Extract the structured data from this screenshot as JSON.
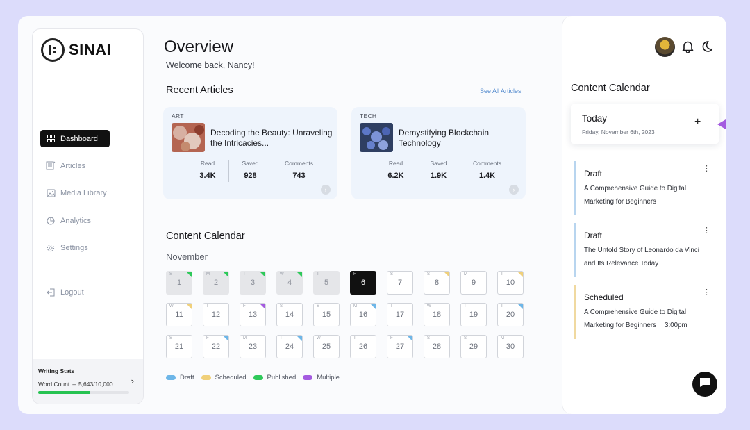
{
  "app": {
    "name": "SINAI"
  },
  "sidebar": {
    "items": [
      {
        "label": "Dashboard",
        "icon": "grid-icon",
        "active": true
      },
      {
        "label": "Articles",
        "icon": "articles-icon"
      },
      {
        "label": "Media Library",
        "icon": "image-icon"
      },
      {
        "label": "Analytics",
        "icon": "pie-chart-icon"
      },
      {
        "label": "Settings",
        "icon": "gear-icon"
      }
    ],
    "logout_label": "Logout",
    "writing_stats": {
      "title": "Writing Stats",
      "label": "Word Count",
      "value": "5,643/10,000",
      "progress": 0.5643
    }
  },
  "header": {
    "title": "Overview",
    "welcome": "Welcome back, Nancy!"
  },
  "recent": {
    "title": "Recent Articles",
    "see_all": "See All Articles",
    "articles": [
      {
        "category": "ART",
        "title": "Decoding the Beauty: Unraveling the Intricacies...",
        "read_label": "Read",
        "read": "3.4K",
        "saved_label": "Saved",
        "saved": "928",
        "comments_label": "Comments",
        "comments": "743"
      },
      {
        "category": "TECH",
        "title": "Demystifying Blockchain Technology",
        "read_label": "Read",
        "read": "6.2K",
        "saved_label": "Saved",
        "saved": "1.9K",
        "comments_label": "Comments",
        "comments": "1.4K"
      }
    ]
  },
  "calendar": {
    "title": "Content Calendar",
    "month": "November",
    "days": [
      {
        "n": "1",
        "wd": "S",
        "state": "past",
        "mark": "published"
      },
      {
        "n": "2",
        "wd": "M",
        "state": "past",
        "mark": "published"
      },
      {
        "n": "3",
        "wd": "T",
        "state": "past",
        "mark": "published"
      },
      {
        "n": "4",
        "wd": "W",
        "state": "past",
        "mark": "published"
      },
      {
        "n": "5",
        "wd": "T",
        "state": "past",
        "mark": ""
      },
      {
        "n": "6",
        "wd": "F",
        "state": "today",
        "mark": ""
      },
      {
        "n": "7",
        "wd": "S",
        "state": "",
        "mark": ""
      },
      {
        "n": "8",
        "wd": "S",
        "state": "",
        "mark": "scheduled"
      },
      {
        "n": "9",
        "wd": "M",
        "state": "",
        "mark": ""
      },
      {
        "n": "10",
        "wd": "T",
        "state": "",
        "mark": "scheduled"
      },
      {
        "n": "11",
        "wd": "W",
        "state": "",
        "mark": "scheduled"
      },
      {
        "n": "12",
        "wd": "T",
        "state": "",
        "mark": ""
      },
      {
        "n": "13",
        "wd": "F",
        "state": "",
        "mark": "multiple"
      },
      {
        "n": "14",
        "wd": "S",
        "state": "",
        "mark": ""
      },
      {
        "n": "15",
        "wd": "S",
        "state": "",
        "mark": ""
      },
      {
        "n": "16",
        "wd": "M",
        "state": "",
        "mark": "draft"
      },
      {
        "n": "17",
        "wd": "T",
        "state": "",
        "mark": ""
      },
      {
        "n": "18",
        "wd": "W",
        "state": "",
        "mark": ""
      },
      {
        "n": "19",
        "wd": "T",
        "state": "",
        "mark": ""
      },
      {
        "n": "20",
        "wd": "T",
        "state": "",
        "mark": "draft"
      },
      {
        "n": "21",
        "wd": "S",
        "state": "",
        "mark": ""
      },
      {
        "n": "22",
        "wd": "F",
        "state": "",
        "mark": "draft"
      },
      {
        "n": "23",
        "wd": "M",
        "state": "",
        "mark": ""
      },
      {
        "n": "24",
        "wd": "T",
        "state": "",
        "mark": "draft"
      },
      {
        "n": "25",
        "wd": "W",
        "state": "",
        "mark": ""
      },
      {
        "n": "26",
        "wd": "T",
        "state": "",
        "mark": ""
      },
      {
        "n": "27",
        "wd": "F",
        "state": "",
        "mark": "draft"
      },
      {
        "n": "28",
        "wd": "S",
        "state": "",
        "mark": ""
      },
      {
        "n": "29",
        "wd": "S",
        "state": "",
        "mark": ""
      },
      {
        "n": "30",
        "wd": "M",
        "state": "",
        "mark": ""
      }
    ],
    "legend": [
      {
        "label": "Draft",
        "color": "#6db6e8"
      },
      {
        "label": "Scheduled",
        "color": "#f0d07a"
      },
      {
        "label": "Published",
        "color": "#2ec95a"
      },
      {
        "label": "Multiple",
        "color": "#a45be0"
      }
    ]
  },
  "right_panel": {
    "title": "Content Calendar",
    "today_label": "Today",
    "today_date": "Friday, November 6th, 2023",
    "entries": [
      {
        "status": "Draft",
        "text": "A Comprehensive Guide to Digital Marketing for Beginners",
        "time": ""
      },
      {
        "status": "Draft",
        "text": "The Untold Story of Leonardo da Vinci and Its Relevance Today",
        "time": ""
      },
      {
        "status": "Scheduled",
        "text": "A Comprehensive Guide to Digital Marketing for Beginners",
        "time": "3:00pm"
      }
    ]
  },
  "colors": {
    "draft": "#6db6e8",
    "scheduled": "#f0d07a",
    "published": "#2ec95a",
    "multiple": "#a45be0",
    "accent": "#111111"
  }
}
